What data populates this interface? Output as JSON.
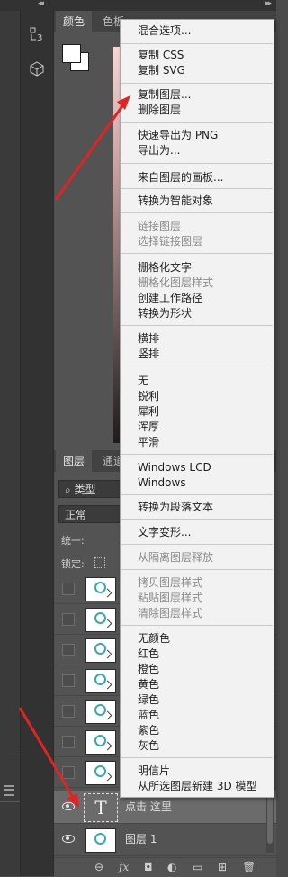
{
  "color_panel": {
    "tabs": [
      "颜色",
      "色板"
    ]
  },
  "layers_panel": {
    "tabs": [
      "图层",
      "通道"
    ],
    "filter_label": "类型",
    "blend_mode": "正常",
    "unify_label": "统一:",
    "lock_label": "锁定:",
    "text_layer_name": "点击 这里",
    "image_layer_name": "图层 1",
    "fx_label": "fx"
  },
  "context_menu": {
    "items": [
      {
        "label": "混合选项...",
        "disabled": false
      },
      {
        "label": "复制 CSS",
        "disabled": false
      },
      {
        "label": "复制 SVG",
        "disabled": false
      },
      {
        "label": "复制图层...",
        "disabled": false
      },
      {
        "label": "删除图层",
        "disabled": false
      },
      {
        "label": "快速导出为 PNG",
        "disabled": false
      },
      {
        "label": "导出为...",
        "disabled": false
      },
      {
        "label": "来自图层的画板...",
        "disabled": false
      },
      {
        "label": "转换为智能对象",
        "disabled": false
      },
      {
        "label": "链接图层",
        "disabled": true
      },
      {
        "label": "选择链接图层",
        "disabled": true
      },
      {
        "label": "栅格化文字",
        "disabled": false
      },
      {
        "label": "栅格化图层样式",
        "disabled": true
      },
      {
        "label": "创建工作路径",
        "disabled": false
      },
      {
        "label": "转换为形状",
        "disabled": false
      },
      {
        "label": "横排",
        "disabled": false
      },
      {
        "label": "竖排",
        "disabled": false
      },
      {
        "label": "无",
        "disabled": false
      },
      {
        "label": "锐利",
        "disabled": false
      },
      {
        "label": "犀利",
        "disabled": false
      },
      {
        "label": "浑厚",
        "disabled": false
      },
      {
        "label": "平滑",
        "disabled": false
      },
      {
        "label": "Windows LCD",
        "disabled": false
      },
      {
        "label": "Windows",
        "disabled": false
      },
      {
        "label": "转换为段落文本",
        "disabled": false
      },
      {
        "label": "文字变形...",
        "disabled": false
      },
      {
        "label": "从隔离图层释放",
        "disabled": true
      },
      {
        "label": "拷贝图层样式",
        "disabled": true
      },
      {
        "label": "粘贴图层样式",
        "disabled": true
      },
      {
        "label": "清除图层样式",
        "disabled": true
      },
      {
        "label": "无颜色",
        "disabled": false
      },
      {
        "label": "红色",
        "disabled": false
      },
      {
        "label": "橙色",
        "disabled": false
      },
      {
        "label": "黄色",
        "disabled": false
      },
      {
        "label": "绿色",
        "disabled": false
      },
      {
        "label": "蓝色",
        "disabled": false
      },
      {
        "label": "紫色",
        "disabled": false
      },
      {
        "label": "灰色",
        "disabled": false
      },
      {
        "label": "明信片",
        "disabled": false
      },
      {
        "label": "从所选图层新建 3D 模型",
        "disabled": false
      }
    ]
  },
  "colors": {
    "annotation_arrow": "#e02424",
    "menu_background": "#f2f2f2",
    "panel_background": "#535353",
    "layer_thumb_accent": "#3aa6b5"
  }
}
